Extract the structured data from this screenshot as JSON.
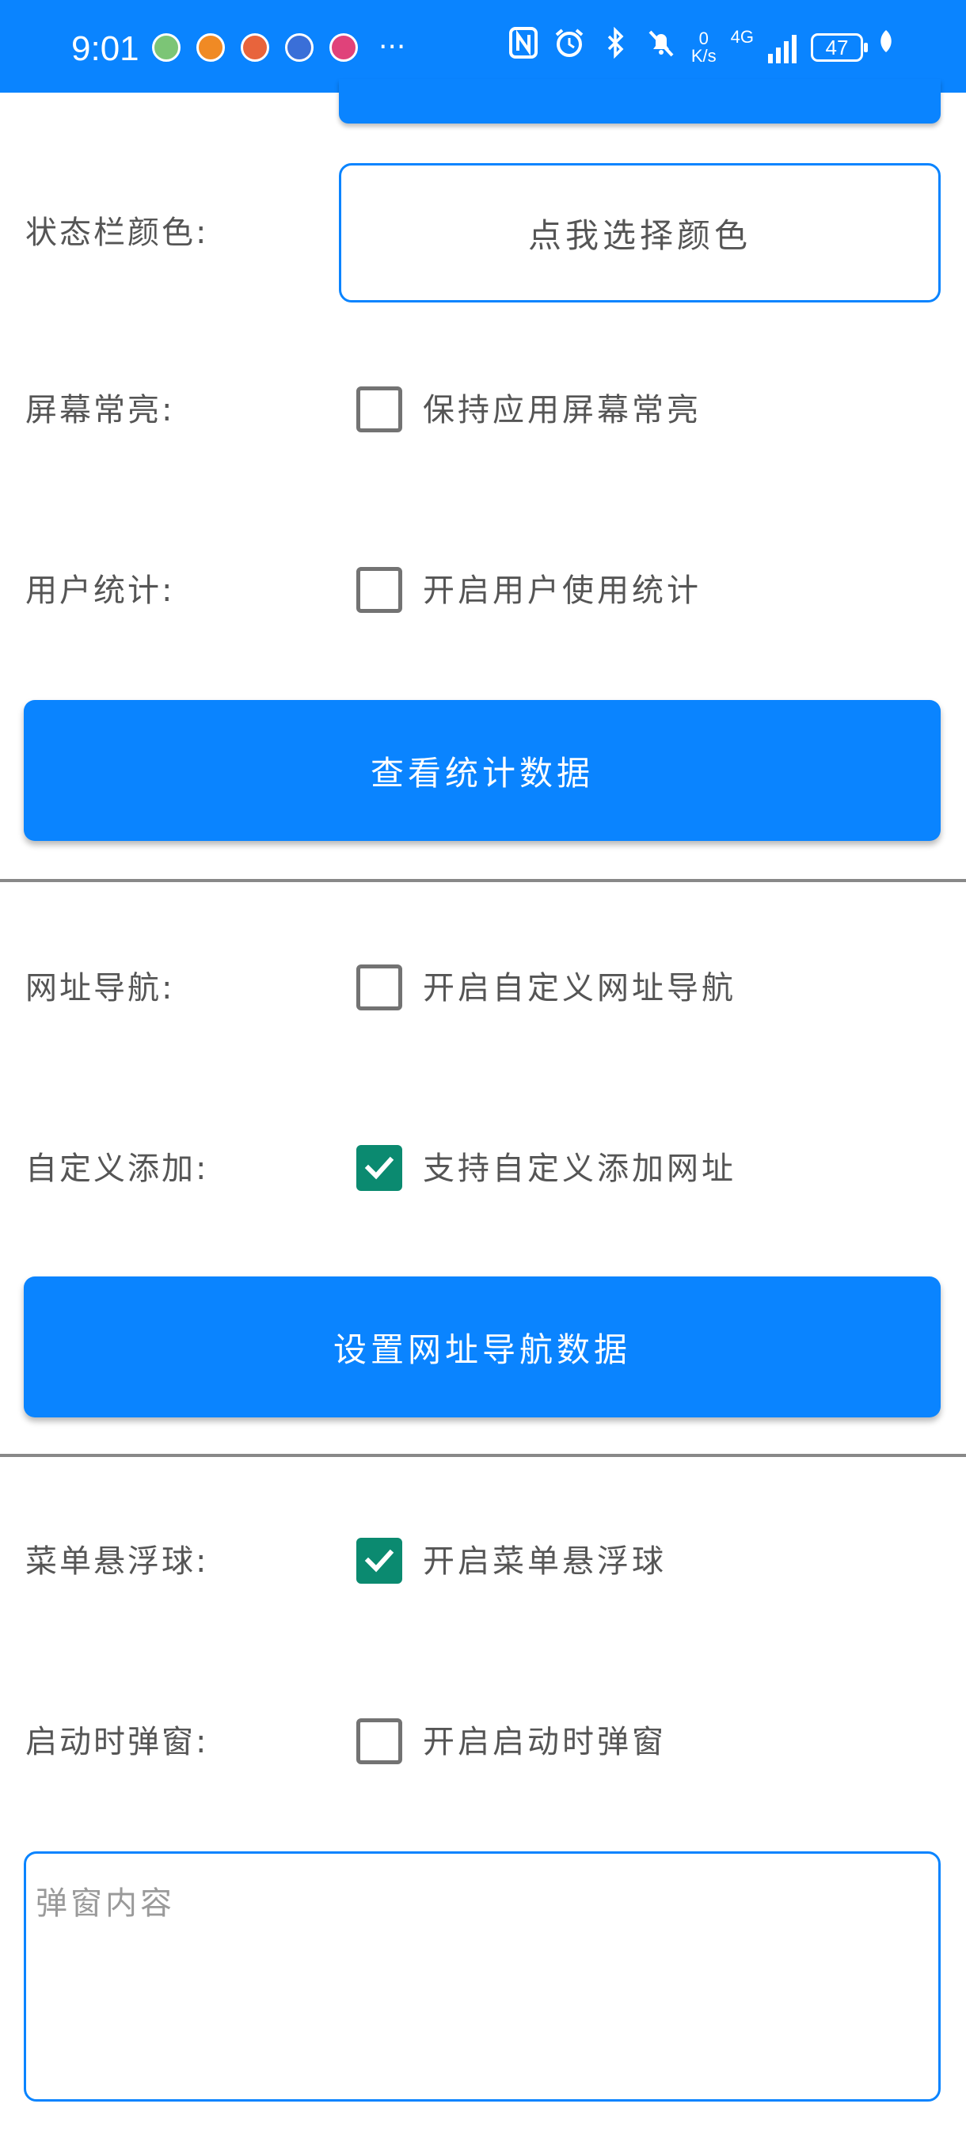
{
  "status_bar": {
    "time": "9:01",
    "more": "···",
    "net_speed_value": "0",
    "net_speed_unit": "K/s",
    "network_type": "4G",
    "battery": "47",
    "icons": [
      "app-icon-1",
      "app-icon-2",
      "app-icon-3",
      "app-icon-4",
      "app-icon-5",
      "nfc-icon",
      "alarm-icon",
      "bluetooth-icon",
      "mute-icon",
      "signal-icon",
      "battery-icon",
      "leaf-icon"
    ]
  },
  "settings": {
    "status_bar_color": {
      "label": "状态栏颜色:",
      "button": "点我选择颜色"
    },
    "keep_screen_on": {
      "label": "屏幕常亮:",
      "option": "保持应用屏幕常亮",
      "checked": false
    },
    "user_stats": {
      "label": "用户统计:",
      "option": "开启用户使用统计",
      "checked": false,
      "button": "查看统计数据"
    },
    "url_nav": {
      "label": "网址导航:",
      "option": "开启自定义网址导航",
      "checked": false
    },
    "custom_add": {
      "label": "自定义添加:",
      "option": "支持自定义添加网址",
      "checked": true,
      "button": "设置网址导航数据"
    },
    "menu_ball": {
      "label": "菜单悬浮球:",
      "option": "开启菜单悬浮球",
      "checked": true
    },
    "startup_popup": {
      "label": "启动时弹窗:",
      "option": "开启启动时弹窗",
      "checked": false,
      "content_value": "",
      "content_placeholder": "弹窗内容"
    }
  },
  "colors": {
    "accent": "#0a84ff",
    "checked": "#0b8a70",
    "text": "#555555"
  }
}
